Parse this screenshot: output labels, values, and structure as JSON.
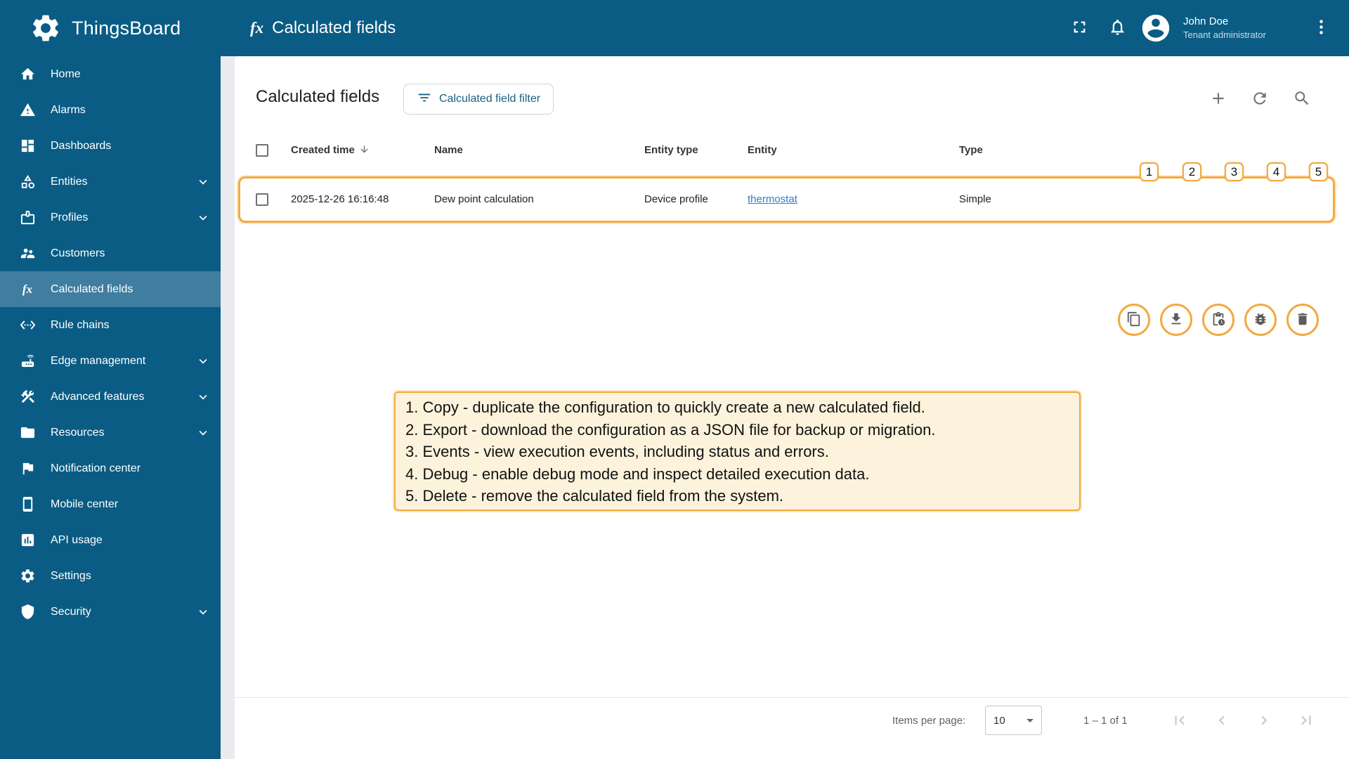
{
  "header": {
    "brand": "ThingsBoard",
    "page_title": "Calculated fields",
    "user": {
      "name": "John Doe",
      "role": "Tenant administrator"
    }
  },
  "icons": {
    "fx_glyph": "fx"
  },
  "sidebar": {
    "items": [
      {
        "label": "Home",
        "icon": "home"
      },
      {
        "label": "Alarms",
        "icon": "warning-triangle"
      },
      {
        "label": "Dashboards",
        "icon": "dashboards-grid"
      },
      {
        "label": "Entities",
        "icon": "category",
        "expandable": true
      },
      {
        "label": "Profiles",
        "icon": "badge",
        "expandable": true
      },
      {
        "label": "Customers",
        "icon": "people"
      },
      {
        "label": "Calculated fields",
        "icon": "fx",
        "selected": true
      },
      {
        "label": "Rule chains",
        "icon": "rule-chains"
      },
      {
        "label": "Edge management",
        "icon": "router",
        "expandable": true
      },
      {
        "label": "Advanced features",
        "icon": "construction",
        "expandable": true
      },
      {
        "label": "Resources",
        "icon": "folder",
        "expandable": true
      },
      {
        "label": "Notification center",
        "icon": "flag"
      },
      {
        "label": "Mobile center",
        "icon": "smartphone"
      },
      {
        "label": "API usage",
        "icon": "chart"
      },
      {
        "label": "Settings",
        "icon": "gear"
      },
      {
        "label": "Security",
        "icon": "shield",
        "expandable": true
      }
    ]
  },
  "content": {
    "title": "Calculated fields",
    "filter_button_label": "Calculated field filter",
    "table": {
      "columns": [
        "Created time",
        "Name",
        "Entity type",
        "Entity",
        "Type"
      ],
      "rows": [
        {
          "created_time": "2025-12-26 16:16:48",
          "name": "Dew point calculation",
          "entity_type": "Device profile",
          "entity": "thermostat",
          "type": "Simple"
        }
      ],
      "row_actions": [
        {
          "number": "1",
          "name": "copy"
        },
        {
          "number": "2",
          "name": "export"
        },
        {
          "number": "3",
          "name": "events"
        },
        {
          "number": "4",
          "name": "debug"
        },
        {
          "number": "5",
          "name": "delete"
        }
      ]
    },
    "annotation": {
      "lines": [
        "1. Copy - duplicate the configuration to quickly create a new calculated field.",
        "2. Export -  download the configuration as a JSON file for backup or migration.",
        "3. Events - view execution events, including status and errors.",
        "4. Debug - enable debug mode and inspect detailed execution data.",
        "5. Delete - remove the calculated field from the system."
      ]
    },
    "paginator": {
      "items_per_page_label": "Items per page:",
      "items_per_page_value": "10",
      "range_label": "1 – 1 of 1"
    }
  },
  "colors": {
    "primary": "#0a5c84",
    "sidebar_selected": "#3f7ea0",
    "annotation_accent": "#f3aa3e",
    "annotation_fill": "#fdf3dc",
    "link": "#2a7fd0"
  }
}
